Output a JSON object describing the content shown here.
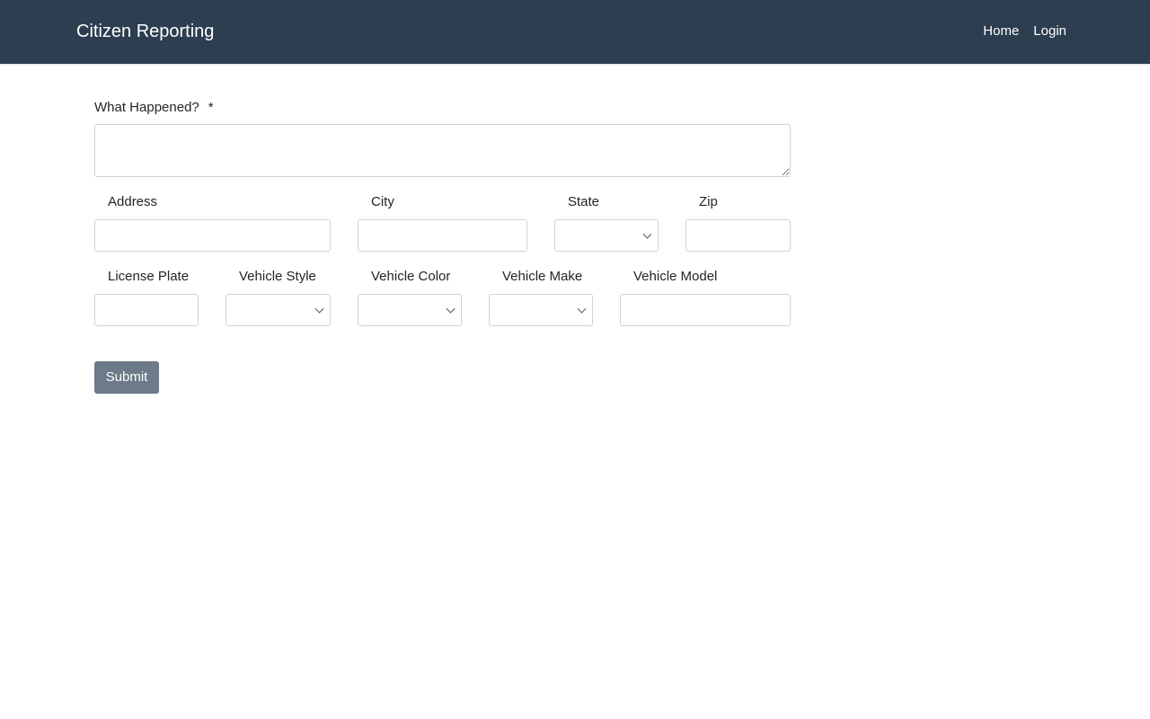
{
  "navbar": {
    "brand": "Citizen Reporting",
    "links": [
      "Home",
      "Login"
    ]
  },
  "form": {
    "what_happened_label": "What Happened?",
    "required_marker": "*",
    "what_happened_value": "",
    "address_label": "Address",
    "address_value": "",
    "city_label": "City",
    "city_value": "",
    "state_label": "State",
    "state_value": "",
    "zip_label": "Zip",
    "zip_value": "",
    "license_plate_label": "License Plate",
    "license_plate_value": "",
    "vehicle_style_label": "Vehicle Style",
    "vehicle_style_value": "",
    "vehicle_color_label": "Vehicle Color",
    "vehicle_color_value": "",
    "vehicle_make_label": "Vehicle Make",
    "vehicle_make_value": "",
    "vehicle_model_label": "Vehicle Model",
    "vehicle_model_value": "",
    "submit_label": "Submit"
  },
  "colors": {
    "navbar_bg": "#2c3e50",
    "button_bg": "#6c7a89",
    "input_border": "#ced4da"
  },
  "icons": {
    "select_arrow": "chevron-down-icon"
  }
}
